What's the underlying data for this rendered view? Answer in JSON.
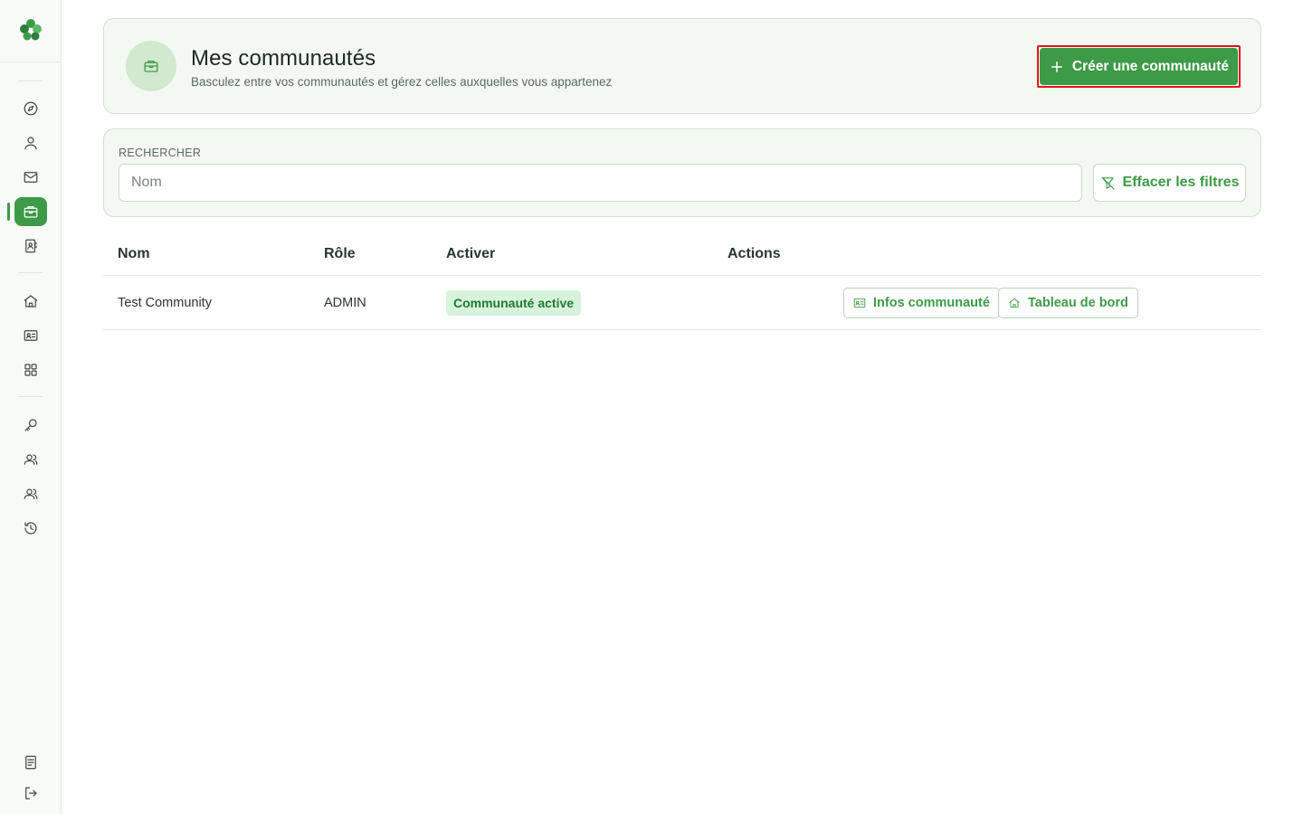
{
  "sidebar": {
    "logo_icon": "clover-logo-icon",
    "items": [
      {
        "name": "explore",
        "icon": "compass-icon",
        "active": false
      },
      {
        "name": "profile",
        "icon": "user-icon",
        "active": false
      },
      {
        "name": "messages",
        "icon": "mail-icon",
        "active": false
      },
      {
        "name": "communities",
        "icon": "briefcase-icon",
        "active": true
      },
      {
        "name": "contacts",
        "icon": "contact-book-icon",
        "active": false
      },
      {
        "name": "home",
        "icon": "home-icon",
        "active": false
      },
      {
        "name": "id-card",
        "icon": "id-card-icon",
        "active": false
      },
      {
        "name": "apps",
        "icon": "grid-icon",
        "active": false
      },
      {
        "name": "keys",
        "icon": "key-icon",
        "active": false
      },
      {
        "name": "members",
        "icon": "users-icon",
        "active": false
      },
      {
        "name": "groups",
        "icon": "users-icon",
        "active": false
      },
      {
        "name": "history",
        "icon": "history-icon",
        "active": false
      },
      {
        "name": "docs",
        "icon": "document-icon",
        "active": false
      },
      {
        "name": "logout",
        "icon": "logout-icon",
        "active": false
      }
    ],
    "accent": "#3d9a47"
  },
  "header": {
    "icon": "briefcase-icon",
    "title": "Mes communautés",
    "subtitle": "Basculez entre vos communautés et gérez celles auxquelles vous appartenez",
    "create_label": "Créer une communauté"
  },
  "search": {
    "label": "RECHERCHER",
    "placeholder": "Nom",
    "value": "",
    "clear_label": "Effacer les filtres"
  },
  "table": {
    "columns": [
      "Nom",
      "Rôle",
      "Activer",
      "Actions"
    ],
    "rows": [
      {
        "name": "Test Community",
        "role": "ADMIN",
        "status": "Communauté active",
        "actions": [
          "Infos communauté",
          "Tableau de bord"
        ]
      }
    ]
  },
  "colors": {
    "primary": "#3d9a47",
    "card_bg": "#f3f9f2",
    "badge_bg": "#d8f3dc",
    "highlight_outline": "#e0141a"
  }
}
